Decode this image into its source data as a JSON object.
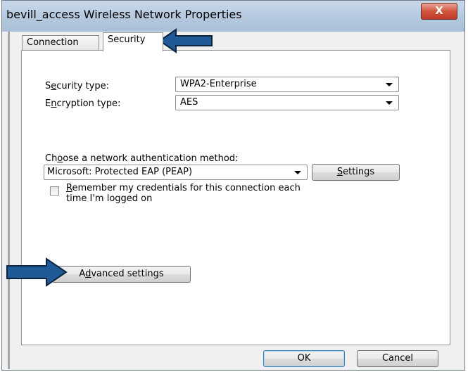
{
  "window": {
    "title": "bevill_access Wireless Network Properties",
    "close_glyph": "X"
  },
  "tabs": [
    {
      "label": "Connection",
      "selected": false
    },
    {
      "label": "Security",
      "selected": true
    }
  ],
  "security": {
    "type_label_pre": "S",
    "type_label_ul": "e",
    "type_label_post": "curity type:",
    "type_value": "WPA2-Enterprise",
    "enc_label_pre": "E",
    "enc_label_ul": "n",
    "enc_label_post": "cryption type:",
    "enc_value": "AES"
  },
  "auth": {
    "choose_pre": "Ch",
    "choose_ul": "o",
    "choose_post": "ose a network authentication method:",
    "method_value": "Microsoft: Protected EAP (PEAP)",
    "settings_ul": "S",
    "settings_post": "ettings",
    "remember_ul": "R",
    "remember_line1_post": "emember my credentials for this connection each",
    "remember_line2": "time I'm logged on",
    "remember_checked": false
  },
  "advanced": {
    "pre": "A",
    "ul": "d",
    "post": "vanced settings"
  },
  "buttons": {
    "ok": "OK",
    "cancel": "Cancel"
  },
  "colors": {
    "callout_arrow_fill": "#1f5a96",
    "callout_arrow_stroke": "#0b2440"
  }
}
